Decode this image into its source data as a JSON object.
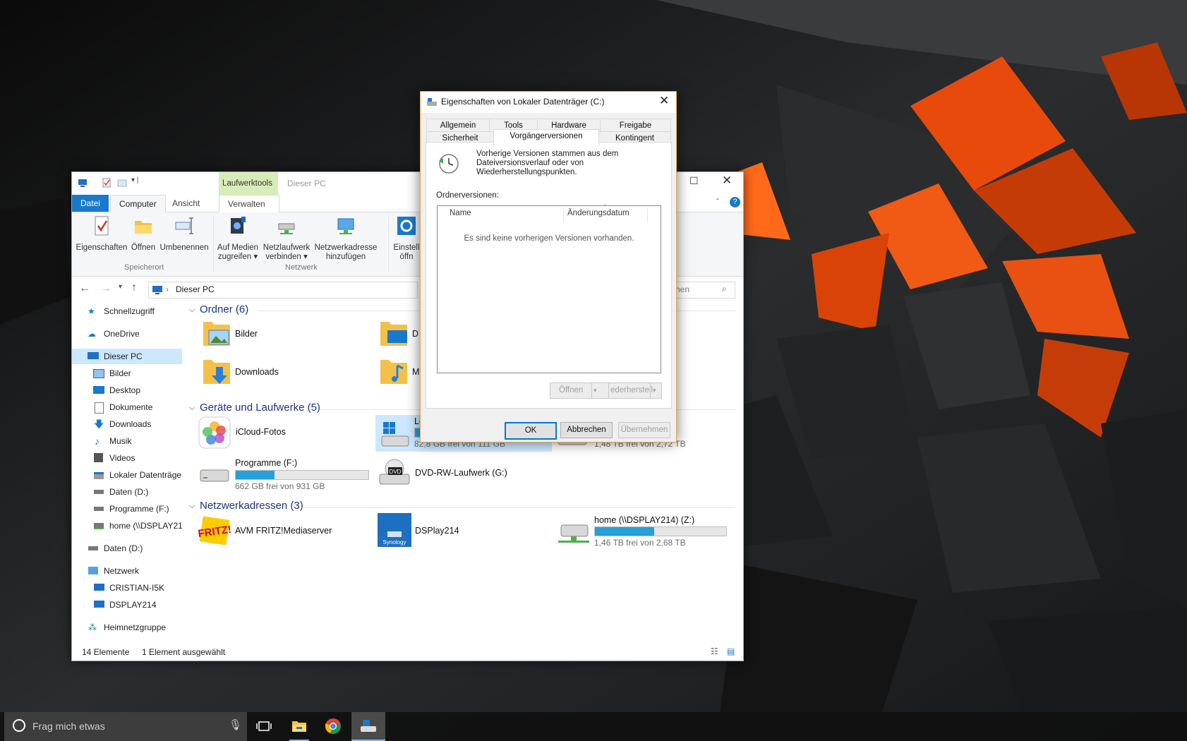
{
  "explorer": {
    "title": "Dieser PC",
    "context_tab": "Laufwerktools",
    "tabs": [
      "Datei",
      "Computer",
      "Ansicht",
      "Verwalten"
    ],
    "ribbon": {
      "buttons": [
        {
          "line1": "Eigenschaften",
          "line2": ""
        },
        {
          "line1": "Öffnen",
          "line2": ""
        },
        {
          "line1": "Umbenennen",
          "line2": ""
        },
        {
          "line1": "Auf Medien",
          "line2": "zugreifen ▾"
        },
        {
          "line1": "Netzlaufwerk",
          "line2": "verbinden ▾"
        },
        {
          "line1": "Netzwerkadresse",
          "line2": "hinzufügen"
        },
        {
          "line1": "Einstell",
          "line2": "öffn"
        }
      ],
      "groups": [
        "Speicherort",
        "Netzwerk"
      ]
    },
    "address": "Dieser PC",
    "search_placeholder": "hen",
    "nav": [
      {
        "label": "Schnellzugriff"
      },
      {
        "label": "OneDrive"
      },
      {
        "label": "Dieser PC"
      },
      {
        "label": "Bilder"
      },
      {
        "label": "Desktop"
      },
      {
        "label": "Dokumente"
      },
      {
        "label": "Downloads"
      },
      {
        "label": "Musik"
      },
      {
        "label": "Videos"
      },
      {
        "label": "Lokaler Datenträger"
      },
      {
        "label": "Daten (D:)"
      },
      {
        "label": "Programme (F:)"
      },
      {
        "label": "home (\\\\DSPLAY21"
      },
      {
        "label": "Daten (D:)"
      },
      {
        "label": "Netzwerk"
      },
      {
        "label": "CRISTIAN-I5K"
      },
      {
        "label": "DSPLAY214"
      },
      {
        "label": "Heimnetzgruppe"
      }
    ],
    "groups": {
      "folders": "Ordner (6)",
      "drives": "Geräte und Laufwerke (5)",
      "network": "Netzwerkadressen (3)"
    },
    "folders": [
      "Bilder",
      "D",
      "Downloads",
      "M"
    ],
    "drives": {
      "icloud": "iCloud-Fotos",
      "c_label": "Lo",
      "c_free": "82,8 GB frei von 111 GB",
      "c_fill": 0.25,
      "d_free": "1,48 TB frei von 2,72 TB",
      "d_fill": 0.46,
      "f_name": "Programme (F:)",
      "f_free": "662 GB frei von 931 GB",
      "f_fill": 0.29,
      "dvd": "DVD-RW-Laufwerk (G:)"
    },
    "network_items": {
      "fritz": "AVM FRITZ!Mediaserver",
      "dsplay": "DSPlay214",
      "home_name": "home (\\\\DSPLAY214) (Z:)",
      "home_free": "1,46 TB frei von 2,68 TB",
      "home_fill": 0.45
    },
    "status": {
      "count": "14 Elemente",
      "selected": "1 Element ausgewählt"
    }
  },
  "dialog": {
    "title": "Eigenschaften von Lokaler Datenträger (C:)",
    "tabs_row1": [
      "Allgemein",
      "Tools",
      "Hardware",
      "Freigabe"
    ],
    "tabs_row2": [
      "Sicherheit",
      "Vorgängerversionen",
      "Kontingent"
    ],
    "info": [
      "Vorherige Versionen stammen aus dem",
      "Dateiversionsverlauf oder von",
      "Wiederherstellungspunkten."
    ],
    "list_label": "Ordnerversionen:",
    "col_name": "Name",
    "col_date": "Änderungsdatum",
    "empty": "Es sind keine vorherigen Versionen vorhanden.",
    "btn_open": "Öffnen",
    "btn_restore": "ederherstell",
    "btn_ok": "OK",
    "btn_cancel": "Abbrechen",
    "btn_apply": "Übernehmen"
  },
  "taskbar": {
    "search_placeholder": "Frag mich etwas"
  },
  "colors": {
    "accent": "#1979ca",
    "context_tab": "#d8ecb9",
    "progress": "#26a0da",
    "dialog_border": "#e5a45a"
  }
}
